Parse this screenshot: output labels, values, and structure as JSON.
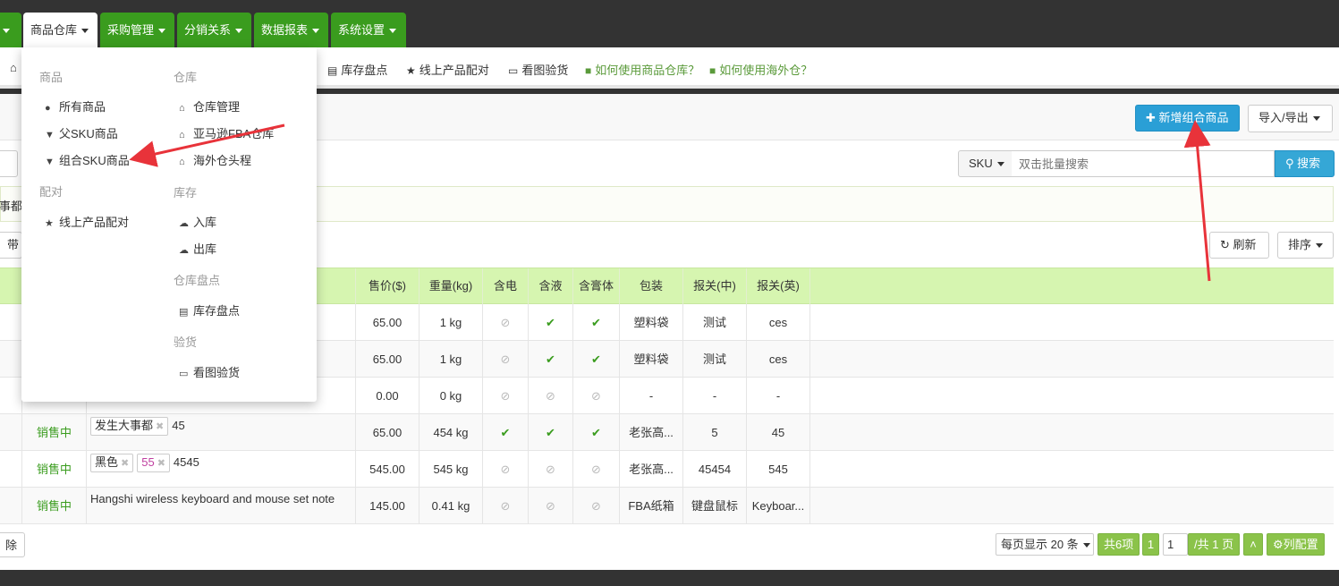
{
  "nav": {
    "tabs": [
      {
        "label": "商品仓库"
      },
      {
        "label": "采购管理"
      },
      {
        "label": "分销关系"
      },
      {
        "label": "数据报表"
      },
      {
        "label": "系统设置"
      }
    ]
  },
  "subbar": {
    "items": [
      "库存盘点",
      "线上产品配对",
      "看图验货",
      "如何使用商品仓库？",
      "如何使用海外仓？"
    ]
  },
  "header": {
    "add_button": "新增组合商品",
    "import_export": "导入/导出"
  },
  "search": {
    "type_label": "SKU",
    "placeholder": "双击批量搜索",
    "button": "搜索"
  },
  "filter_fragment": "事都",
  "toolbar": {
    "left_fragment": "带",
    "refresh": "刷新",
    "sort": "排序"
  },
  "table": {
    "headers": [
      "售价($)",
      "重量(kg)",
      "含电",
      "含液",
      "含膏体",
      "包装",
      "报关(中)",
      "报关(英)"
    ],
    "rows": [
      {
        "status": "",
        "tags": [],
        "name": "",
        "price": "65.00",
        "weight": "1 kg",
        "elec": true,
        "liquid": false,
        "paste": false,
        "pkg": "塑料袋",
        "cn": "测试",
        "en": "ces",
        "flags": [
          false,
          true,
          true
        ]
      },
      {
        "status": "",
        "tags": [],
        "name": "",
        "price": "65.00",
        "weight": "1 kg",
        "pkg": "塑料袋",
        "cn": "测试",
        "en": "ces",
        "flags": [
          false,
          true,
          true
        ]
      },
      {
        "status": "",
        "tags": [],
        "name": "",
        "price": "0.00",
        "weight": "0 kg",
        "pkg": "-",
        "cn": "-",
        "en": "-",
        "flags": [
          false,
          false,
          false
        ]
      },
      {
        "status": "销售中",
        "tags": [
          {
            "text": "发生大事都",
            "pink": false
          }
        ],
        "name": "45",
        "price": "65.00",
        "weight": "454 kg",
        "pkg": "老张高...",
        "cn": "5",
        "en": "45",
        "flags": [
          true,
          true,
          true
        ]
      },
      {
        "status": "销售中",
        "tags": [
          {
            "text": "黑色",
            "pink": false
          },
          {
            "text": "55",
            "pink": true
          }
        ],
        "name": "4545",
        "price": "545.00",
        "weight": "545 kg",
        "pkg": "老张高...",
        "cn": "45454",
        "en": "545",
        "flags": [
          false,
          false,
          false
        ]
      },
      {
        "status": "销售中",
        "tags": [],
        "name": "Hangshi wireless keyboard and mouse set note",
        "price": "145.00",
        "weight": "0.41 kg",
        "pkg": "FBA纸箱",
        "cn": "键盘鼠标",
        "en": "Keyboar...",
        "flags": [
          false,
          false,
          false
        ]
      }
    ]
  },
  "footer": {
    "delete_fragment": "除",
    "per_page": "每页显示 20 条",
    "total": "共6项",
    "page_num": "1",
    "page_input": "1",
    "page_total": "/共 1 页",
    "column_config": "列配置"
  },
  "dropdown": {
    "sections": {
      "goods": "商品",
      "warehouse": "仓库",
      "match": "配对",
      "stock": "库存",
      "check": "仓库盘点",
      "inspect": "验货"
    },
    "items": {
      "all_goods": "所有商品",
      "parent_sku": "父SKU商品",
      "combo_sku": "组合SKU商品",
      "wh_manage": "仓库管理",
      "amazon_fba": "亚马逊FBA仓库",
      "overseas": "海外仓头程",
      "online_match": "线上产品配对",
      "inbound": "入库",
      "outbound": "出库",
      "stock_check": "库存盘点",
      "image_inspect": "看图验货"
    }
  },
  "colors": {
    "nav_green": "#3a9c1e",
    "header_green": "#d6f5b0",
    "info_blue": "#2a9fd6",
    "arrow_red": "#e8333a"
  }
}
